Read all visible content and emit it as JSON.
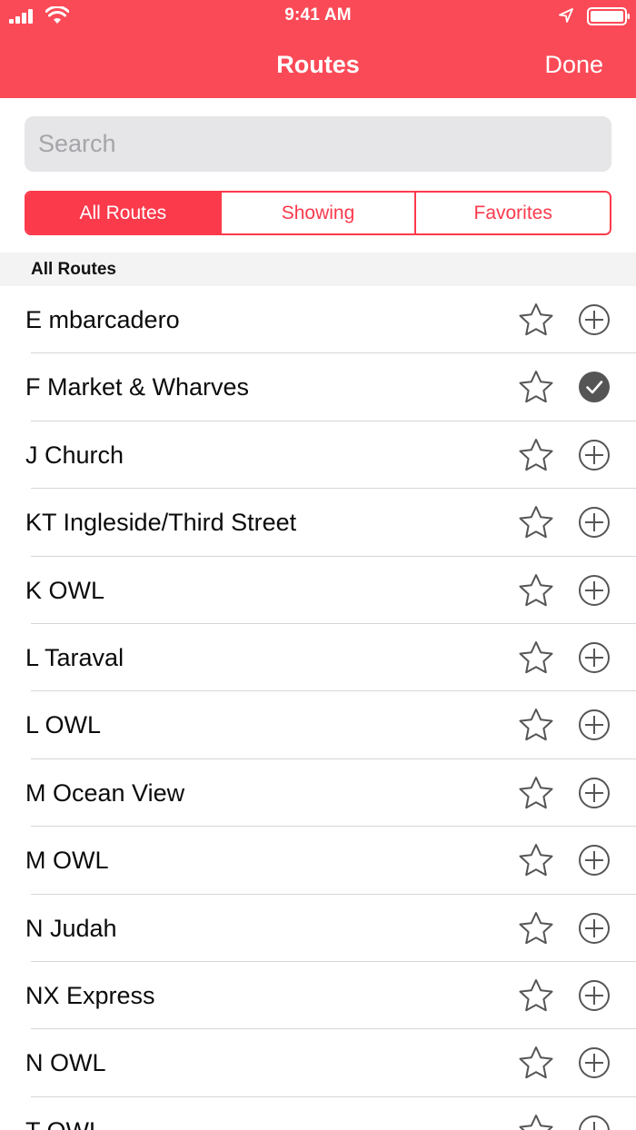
{
  "status_bar": {
    "time": "9:41 AM",
    "signal_icon": "cellular-signal-icon",
    "wifi_icon": "wifi-icon",
    "location_icon": "location-arrow-icon",
    "battery_icon": "battery-icon"
  },
  "nav": {
    "title": "Routes",
    "done_label": "Done"
  },
  "search": {
    "placeholder": "Search",
    "value": ""
  },
  "segments": [
    {
      "label": "All Routes",
      "selected": true
    },
    {
      "label": "Showing",
      "selected": false
    },
    {
      "label": "Favorites",
      "selected": false
    }
  ],
  "section_header": "All Routes",
  "routes": [
    {
      "label": "E mbarcadero",
      "favorite": false,
      "added": false
    },
    {
      "label": "F Market & Wharves",
      "favorite": false,
      "added": true
    },
    {
      "label": "J Church",
      "favorite": false,
      "added": false
    },
    {
      "label": "KT Ingleside/Third Street",
      "favorite": false,
      "added": false
    },
    {
      "label": "K OWL",
      "favorite": false,
      "added": false
    },
    {
      "label": "L Taraval",
      "favorite": false,
      "added": false
    },
    {
      "label": "L OWL",
      "favorite": false,
      "added": false
    },
    {
      "label": "M Ocean View",
      "favorite": false,
      "added": false
    },
    {
      "label": "M OWL",
      "favorite": false,
      "added": false
    },
    {
      "label": "N Judah",
      "favorite": false,
      "added": false
    },
    {
      "label": "NX Express",
      "favorite": false,
      "added": false
    },
    {
      "label": "N OWL",
      "favorite": false,
      "added": false
    },
    {
      "label": "T OWL",
      "favorite": false,
      "added": false
    }
  ],
  "colors": {
    "accent": "#fb4a57",
    "segment_accent": "#fb3a4c",
    "icon_gray": "#555555"
  }
}
